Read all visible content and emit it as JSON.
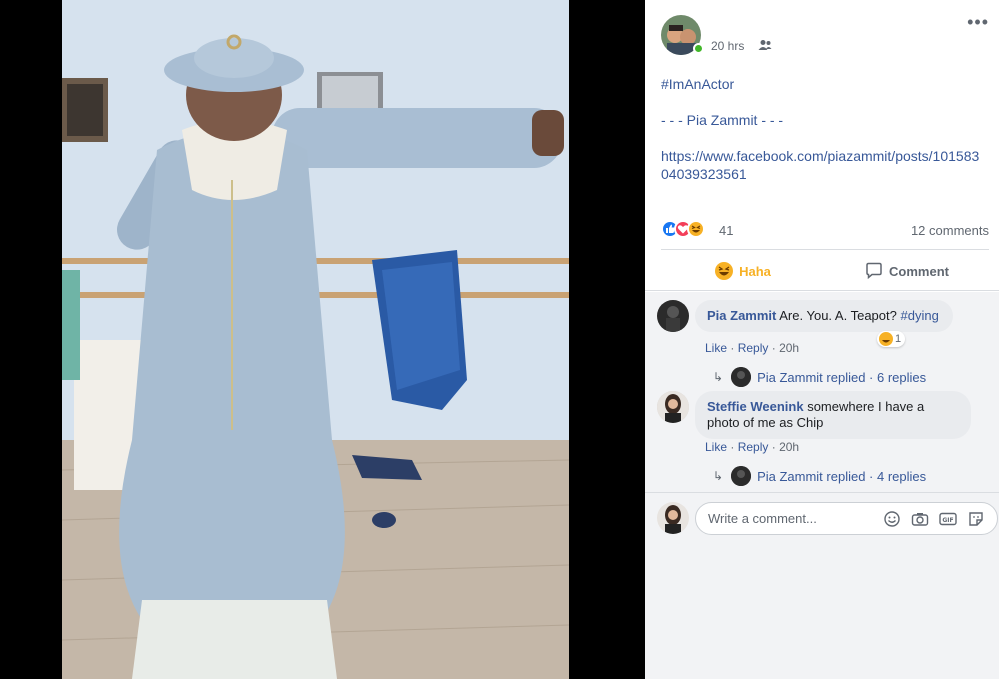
{
  "post": {
    "time": "20 hrs",
    "hashtag": "#ImAnActor",
    "author_line": "- - - Pia Zammit - - -",
    "url": "https://www.facebook.com/piazammit/posts/10158304039323561",
    "reaction_count": "41",
    "comments_count": "12 comments",
    "more_label": "•••"
  },
  "actions": {
    "haha_label": "Haha",
    "comment_label": "Comment"
  },
  "comments": [
    {
      "name": "Pia Zammit",
      "text": "Are. You. A. Teapot?",
      "tag": "#dying",
      "reaction_count": "1",
      "like": "Like",
      "reply": "Reply",
      "time": "20h",
      "replies": "Pia Zammit replied · 6 replies"
    },
    {
      "name": "Steffie Weenink",
      "text": "somewhere I have a photo of me as Chip",
      "like": "Like",
      "reply": "Reply",
      "time": "20h",
      "replies": "Pia Zammit replied · 4 replies"
    }
  ],
  "composer": {
    "placeholder": "Write a comment..."
  },
  "colors": {
    "link": "#385898",
    "haha": "#f7b125",
    "online": "#42b72a",
    "like_blue": "#1877f2",
    "love_red": "#f33e58"
  },
  "icons": [
    "audience-friends-icon",
    "like-reaction-icon",
    "love-reaction-icon",
    "haha-reaction-icon",
    "comment-icon",
    "reply-arrow-icon",
    "emoji-icon",
    "camera-icon",
    "gif-icon",
    "sticker-icon"
  ]
}
